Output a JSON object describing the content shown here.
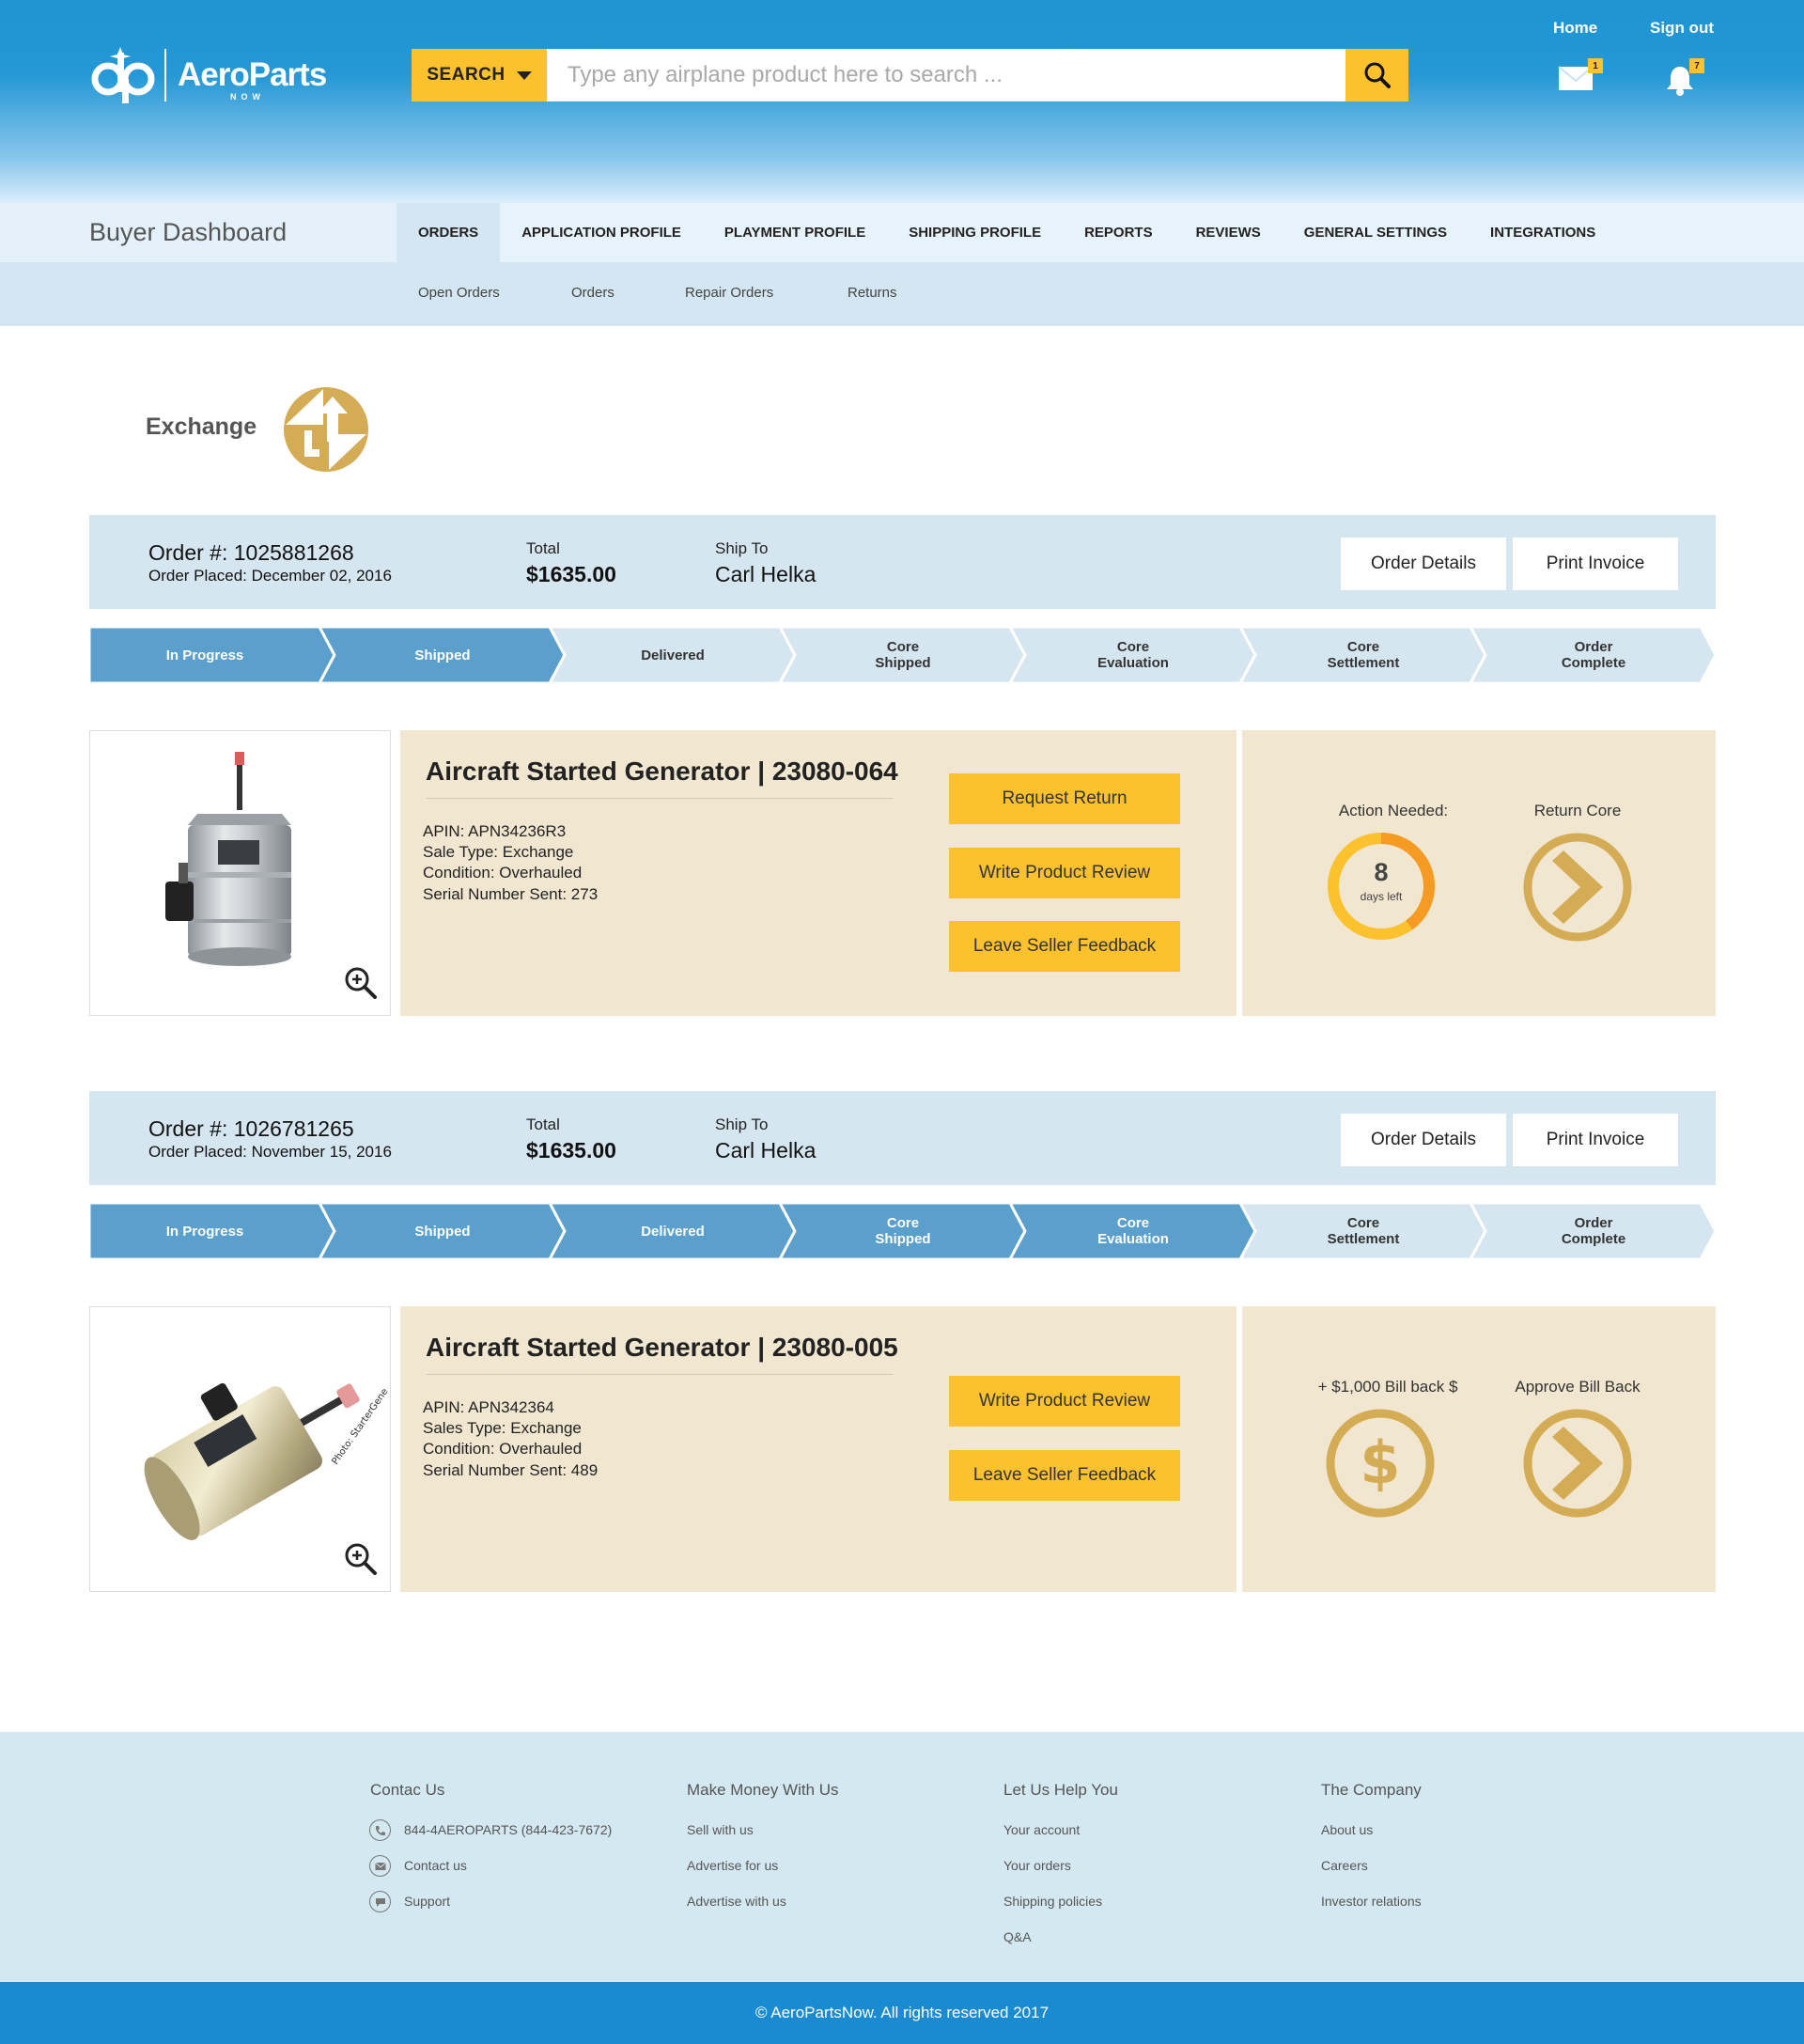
{
  "header": {
    "logo_text": "AeroParts",
    "logo_sub": "NOW",
    "search_button": "SEARCH",
    "search_placeholder": "Type any airplane product here to search ...",
    "home": "Home",
    "signout": "Sign out",
    "mail_badge": "1",
    "bell_badge": "7"
  },
  "nav": {
    "title": "Buyer Dashboard",
    "tabs": [
      "ORDERS",
      "APPLICATION PROFILE",
      "PLAYMENT PROFILE",
      "SHIPPING PROFILE",
      "REPORTS",
      "REVIEWS",
      "GENERAL SETTINGS",
      "INTEGRATIONS"
    ],
    "subtabs": [
      "Open Orders",
      "Orders",
      "Repair Orders",
      "Returns"
    ]
  },
  "exchange_label": "Exchange",
  "orders": [
    {
      "number": "Order #: 1025881268",
      "placed": "Order Placed: December 02, 2016",
      "total_label": "Total",
      "total": "$1635.00",
      "shipto_label": "Ship To",
      "shipto": "Carl Helka",
      "details_btn": "Order Details",
      "invoice_btn": "Print Invoice",
      "steps": [
        "In Progress",
        "Shipped",
        "Delivered",
        "Core\nShipped",
        "Core\nEvaluation",
        "Core\nSettlement",
        "Order\nComplete"
      ],
      "completed_steps": 2,
      "product_title": "Aircraft Started Generator | 23080-064",
      "specs": [
        "APIN: APN34236R3",
        "Sale Type: Exchange",
        "Condition: Overhauled",
        "Serial Number Sent: 273"
      ],
      "actions": [
        "Request Return",
        "Write Product Review",
        "Leave Seller Feedback"
      ],
      "side_left_label": "Action Needed:",
      "countdown_value": "8",
      "countdown_unit": "days left",
      "countdown_fraction": 0.4,
      "side_right_label": "Return Core"
    },
    {
      "number": "Order #: 1026781265",
      "placed": "Order Placed: November 15, 2016",
      "total_label": "Total",
      "total": "$1635.00",
      "shipto_label": "Ship To",
      "shipto": "Carl Helka",
      "details_btn": "Order Details",
      "invoice_btn": "Print Invoice",
      "steps": [
        "In Progress",
        "Shipped",
        "Delivered",
        "Core\nShipped",
        "Core\nEvaluation",
        "Core\nSettlement",
        "Order\nComplete"
      ],
      "completed_steps": 5,
      "product_title": "Aircraft Started Generator | 23080-005",
      "specs": [
        "APIN: APN342364",
        "Sales Type: Exchange",
        "Condition: Overhauled",
        "Serial Number Sent: 489"
      ],
      "actions": [
        "Write Product Review",
        "Leave Seller Feedback"
      ],
      "side_left_label": "+ $1,000 Bill back $",
      "side_right_label": "Approve Bill Back"
    }
  ],
  "footer": {
    "columns": [
      {
        "title": "Contac Us",
        "links": [
          "844-4AEROPARTS (844-423-7672)",
          "Contact us",
          "Support"
        ]
      },
      {
        "title": "Make Money With Us",
        "links": [
          "Sell with us",
          "Advertise for us",
          "Advertise with us"
        ]
      },
      {
        "title": "Let Us Help You",
        "links": [
          "Your account",
          "Your orders",
          "Shipping policies",
          "Q&A"
        ]
      },
      {
        "title": "The Company",
        "links": [
          "About us",
          "Careers",
          "Investor relations"
        ]
      }
    ],
    "copyright": "© AeroPartsNow. All rights reserved 2017"
  },
  "colors": {
    "header_blue": "#1e94d3",
    "accent_yellow": "#fcc22d",
    "step_done": "#5b9fcc",
    "step_todo": "#d5e6f1",
    "card_beige": "#f1e6cf",
    "gold_icon": "#d5ac56",
    "countdown_orange": "#f59a23"
  }
}
